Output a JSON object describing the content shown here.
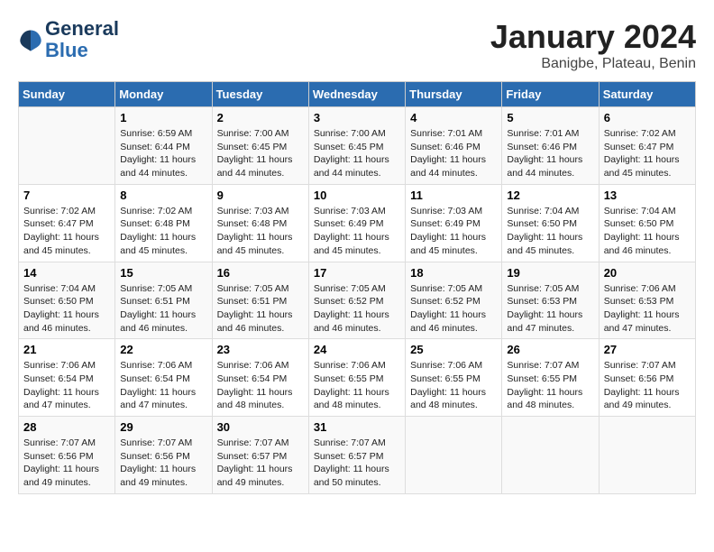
{
  "header": {
    "logo_line1": "General",
    "logo_line2": "Blue",
    "month": "January 2024",
    "location": "Banigbe, Plateau, Benin"
  },
  "columns": [
    "Sunday",
    "Monday",
    "Tuesday",
    "Wednesday",
    "Thursday",
    "Friday",
    "Saturday"
  ],
  "weeks": [
    [
      {
        "day": "",
        "info": ""
      },
      {
        "day": "1",
        "info": "Sunrise: 6:59 AM\nSunset: 6:44 PM\nDaylight: 11 hours\nand 44 minutes."
      },
      {
        "day": "2",
        "info": "Sunrise: 7:00 AM\nSunset: 6:45 PM\nDaylight: 11 hours\nand 44 minutes."
      },
      {
        "day": "3",
        "info": "Sunrise: 7:00 AM\nSunset: 6:45 PM\nDaylight: 11 hours\nand 44 minutes."
      },
      {
        "day": "4",
        "info": "Sunrise: 7:01 AM\nSunset: 6:46 PM\nDaylight: 11 hours\nand 44 minutes."
      },
      {
        "day": "5",
        "info": "Sunrise: 7:01 AM\nSunset: 6:46 PM\nDaylight: 11 hours\nand 44 minutes."
      },
      {
        "day": "6",
        "info": "Sunrise: 7:02 AM\nSunset: 6:47 PM\nDaylight: 11 hours\nand 45 minutes."
      }
    ],
    [
      {
        "day": "7",
        "info": "Sunrise: 7:02 AM\nSunset: 6:47 PM\nDaylight: 11 hours\nand 45 minutes."
      },
      {
        "day": "8",
        "info": "Sunrise: 7:02 AM\nSunset: 6:48 PM\nDaylight: 11 hours\nand 45 minutes."
      },
      {
        "day": "9",
        "info": "Sunrise: 7:03 AM\nSunset: 6:48 PM\nDaylight: 11 hours\nand 45 minutes."
      },
      {
        "day": "10",
        "info": "Sunrise: 7:03 AM\nSunset: 6:49 PM\nDaylight: 11 hours\nand 45 minutes."
      },
      {
        "day": "11",
        "info": "Sunrise: 7:03 AM\nSunset: 6:49 PM\nDaylight: 11 hours\nand 45 minutes."
      },
      {
        "day": "12",
        "info": "Sunrise: 7:04 AM\nSunset: 6:50 PM\nDaylight: 11 hours\nand 45 minutes."
      },
      {
        "day": "13",
        "info": "Sunrise: 7:04 AM\nSunset: 6:50 PM\nDaylight: 11 hours\nand 46 minutes."
      }
    ],
    [
      {
        "day": "14",
        "info": "Sunrise: 7:04 AM\nSunset: 6:50 PM\nDaylight: 11 hours\nand 46 minutes."
      },
      {
        "day": "15",
        "info": "Sunrise: 7:05 AM\nSunset: 6:51 PM\nDaylight: 11 hours\nand 46 minutes."
      },
      {
        "day": "16",
        "info": "Sunrise: 7:05 AM\nSunset: 6:51 PM\nDaylight: 11 hours\nand 46 minutes."
      },
      {
        "day": "17",
        "info": "Sunrise: 7:05 AM\nSunset: 6:52 PM\nDaylight: 11 hours\nand 46 minutes."
      },
      {
        "day": "18",
        "info": "Sunrise: 7:05 AM\nSunset: 6:52 PM\nDaylight: 11 hours\nand 46 minutes."
      },
      {
        "day": "19",
        "info": "Sunrise: 7:05 AM\nSunset: 6:53 PM\nDaylight: 11 hours\nand 47 minutes."
      },
      {
        "day": "20",
        "info": "Sunrise: 7:06 AM\nSunset: 6:53 PM\nDaylight: 11 hours\nand 47 minutes."
      }
    ],
    [
      {
        "day": "21",
        "info": "Sunrise: 7:06 AM\nSunset: 6:54 PM\nDaylight: 11 hours\nand 47 minutes."
      },
      {
        "day": "22",
        "info": "Sunrise: 7:06 AM\nSunset: 6:54 PM\nDaylight: 11 hours\nand 47 minutes."
      },
      {
        "day": "23",
        "info": "Sunrise: 7:06 AM\nSunset: 6:54 PM\nDaylight: 11 hours\nand 48 minutes."
      },
      {
        "day": "24",
        "info": "Sunrise: 7:06 AM\nSunset: 6:55 PM\nDaylight: 11 hours\nand 48 minutes."
      },
      {
        "day": "25",
        "info": "Sunrise: 7:06 AM\nSunset: 6:55 PM\nDaylight: 11 hours\nand 48 minutes."
      },
      {
        "day": "26",
        "info": "Sunrise: 7:07 AM\nSunset: 6:55 PM\nDaylight: 11 hours\nand 48 minutes."
      },
      {
        "day": "27",
        "info": "Sunrise: 7:07 AM\nSunset: 6:56 PM\nDaylight: 11 hours\nand 49 minutes."
      }
    ],
    [
      {
        "day": "28",
        "info": "Sunrise: 7:07 AM\nSunset: 6:56 PM\nDaylight: 11 hours\nand 49 minutes."
      },
      {
        "day": "29",
        "info": "Sunrise: 7:07 AM\nSunset: 6:56 PM\nDaylight: 11 hours\nand 49 minutes."
      },
      {
        "day": "30",
        "info": "Sunrise: 7:07 AM\nSunset: 6:57 PM\nDaylight: 11 hours\nand 49 minutes."
      },
      {
        "day": "31",
        "info": "Sunrise: 7:07 AM\nSunset: 6:57 PM\nDaylight: 11 hours\nand 50 minutes."
      },
      {
        "day": "",
        "info": ""
      },
      {
        "day": "",
        "info": ""
      },
      {
        "day": "",
        "info": ""
      }
    ]
  ]
}
